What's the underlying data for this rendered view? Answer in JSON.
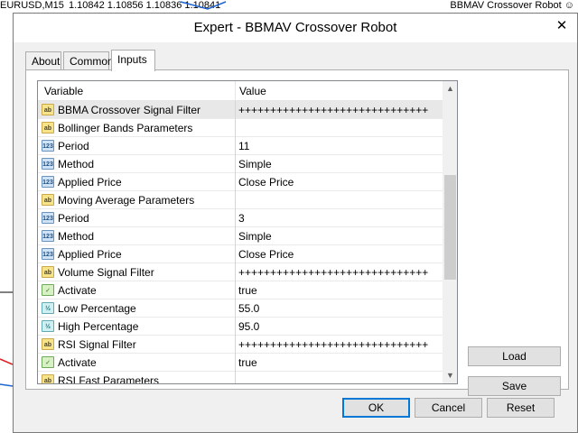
{
  "chart": {
    "symbol": "EURUSD,M15",
    "prices": "1.10842 1.10856 1.10836 1.10841",
    "robot_name": "BBMAV Crossover Robot"
  },
  "dialog": {
    "title": "Expert - BBMAV Crossover Robot",
    "close_glyph": "✕",
    "tabs": [
      "About",
      "Common",
      "Inputs"
    ],
    "active_tab": "Inputs",
    "grid": {
      "header_variable": "Variable",
      "header_value": "Value",
      "rows": [
        {
          "type": "ab",
          "name": "BBMA Crossover Signal Filter",
          "value": "++++++++++++++++++++++++++++++"
        },
        {
          "type": "ab",
          "name": "Bollinger Bands Parameters",
          "value": ""
        },
        {
          "type": "num",
          "name": "Period",
          "value": "11"
        },
        {
          "type": "num",
          "name": "Method",
          "value": "Simple"
        },
        {
          "type": "num",
          "name": "Applied Price",
          "value": "Close Price"
        },
        {
          "type": "ab",
          "name": "Moving Average Parameters",
          "value": ""
        },
        {
          "type": "num",
          "name": "Period",
          "value": "3"
        },
        {
          "type": "num",
          "name": "Method",
          "value": "Simple"
        },
        {
          "type": "num",
          "name": "Applied Price",
          "value": "Close Price"
        },
        {
          "type": "ab",
          "name": "Volume Signal Filter",
          "value": "++++++++++++++++++++++++++++++"
        },
        {
          "type": "bool",
          "name": "Activate",
          "value": "true"
        },
        {
          "type": "dbl",
          "name": "Low Percentage",
          "value": "55.0"
        },
        {
          "type": "dbl",
          "name": "High Percentage",
          "value": "95.0"
        },
        {
          "type": "ab",
          "name": "RSI Signal Filter",
          "value": "++++++++++++++++++++++++++++++"
        },
        {
          "type": "bool",
          "name": "Activate",
          "value": "true"
        },
        {
          "type": "ab",
          "name": "RSI Fast Parameters",
          "value": ""
        }
      ]
    },
    "icon_labels": {
      "ab": "ab",
      "num": "123",
      "bool": "✓",
      "dbl": "½"
    },
    "buttons": {
      "load": "Load",
      "save": "Save",
      "ok": "OK",
      "cancel": "Cancel",
      "reset": "Reset"
    },
    "scroll_up": "▲",
    "scroll_down": "▼"
  }
}
